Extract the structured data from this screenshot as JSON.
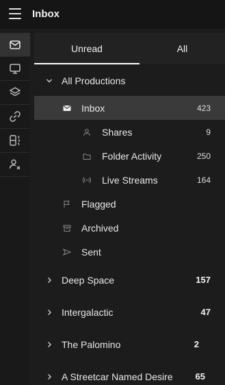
{
  "header": {
    "title": "Inbox",
    "menu_icon": "hamburger-menu-icon"
  },
  "rail": {
    "items": [
      {
        "name": "mail",
        "icon": "mail-icon",
        "active": true
      },
      {
        "name": "monitor",
        "icon": "monitor-icon",
        "active": false
      },
      {
        "name": "layers",
        "icon": "layers-icon",
        "active": false
      },
      {
        "name": "link",
        "icon": "link-icon",
        "active": false
      },
      {
        "name": "storage",
        "icon": "storage-icon",
        "active": false
      },
      {
        "name": "user-remove",
        "icon": "user-remove-icon",
        "active": false
      }
    ]
  },
  "tabs": {
    "unread": "Unread",
    "all": "All",
    "selected": "Unread"
  },
  "tree": {
    "all_productions": {
      "label": "All Productions"
    },
    "inbox": {
      "label": "Inbox",
      "count": "423"
    },
    "shares": {
      "label": "Shares",
      "count": "9"
    },
    "folder_activity": {
      "label": "Folder Activity",
      "count": "250"
    },
    "live_streams": {
      "label": "Live Streams",
      "count": "164"
    },
    "flagged": {
      "label": "Flagged"
    },
    "archived": {
      "label": "Archived"
    },
    "sent": {
      "label": "Sent"
    },
    "productions": [
      {
        "label": "Deep Space",
        "count": "157"
      },
      {
        "label": "Intergalactic",
        "count": "47"
      },
      {
        "label": "The Palomino",
        "count": "2"
      },
      {
        "label": "A Streetcar Named Desire",
        "count": "65"
      }
    ]
  },
  "colors": {
    "background": "#1c1c1c",
    "selected_row": "#3a3a3a",
    "text": "#e8e8e8",
    "muted_icon": "#8a8a8a"
  }
}
